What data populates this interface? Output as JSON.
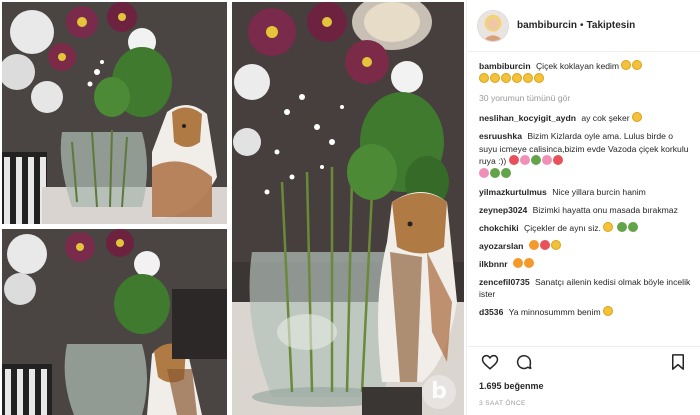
{
  "post": {
    "author": "bambiburcin",
    "separator": "•",
    "follow_status": "Takiptesin",
    "caption_user": "bambiburcin",
    "caption_text": "Çiçek koklayan kedim",
    "view_all": "30 yorumun tümünü gör",
    "likes": "1.695 beğenme",
    "timestamp": "3 SAAT ÖNCE"
  },
  "comments": [
    {
      "user": "neslihan_kocyigit_aydn",
      "text": "ay cok şeker"
    },
    {
      "user": "esruushka",
      "text": "Bizim Kizlarda oyle ama. Lulus birde o suyu icmeye calisinca,bizim evde Vazoda çiçek korkulu ruya :))"
    },
    {
      "user": "yilmazkurtulmus",
      "text": "Nice yillara burcin hanim"
    },
    {
      "user": "zeynep3024",
      "text": "Bizimki hayatta onu masada bırakmaz"
    },
    {
      "user": "chokchiki",
      "text": "Çiçekler de aynı siz."
    },
    {
      "user": "ayozarslan",
      "text": ""
    },
    {
      "user": "ilkbnnr",
      "text": ""
    },
    {
      "user": "zencefil0735",
      "text": "Sanatçı ailenin kedisi olmak böyle incelik ister"
    },
    {
      "user": "d3536",
      "text": "Ya minnosummm benim"
    }
  ],
  "icons": {
    "like": "heart-icon",
    "comment": "comment-bubble-icon",
    "save": "bookmark-icon"
  },
  "colors": {
    "text": "#262626",
    "muted": "#999999",
    "border": "#efefef"
  }
}
